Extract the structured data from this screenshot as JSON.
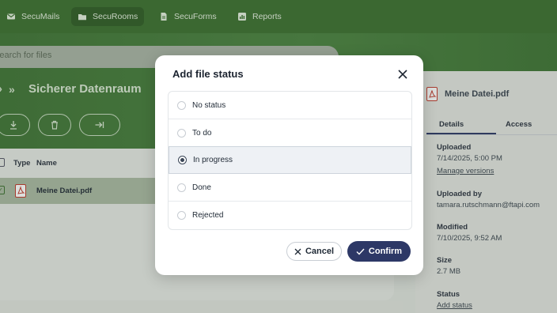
{
  "nav": {
    "items": [
      {
        "label": "SecuMails",
        "icon": "mail-icon"
      },
      {
        "label": "SecuRooms",
        "icon": "folder-icon",
        "active": true
      },
      {
        "label": "SecuForms",
        "icon": "form-icon"
      },
      {
        "label": "Reports",
        "icon": "chart-icon"
      }
    ]
  },
  "search": {
    "placeholder": "Search for files"
  },
  "room": {
    "title": "Sicherer Datenraum"
  },
  "table": {
    "headers": [
      "Type",
      "Name"
    ],
    "rows": [
      {
        "name": "Meine Datei.pdf",
        "type_icon": "pdf-icon"
      }
    ]
  },
  "side_panel": {
    "file_name": "Meine Datei.pdf",
    "tabs": [
      "Details",
      "Access"
    ],
    "uploaded_label": "Uploaded",
    "uploaded_value": "7/14/2025, 5:00 PM",
    "manage_versions": "Manage versions",
    "uploaded_by_label": "Uploaded by",
    "uploaded_by_value": "tamara.rutschmann@ftapi.com",
    "modified_label": "Modified",
    "modified_value": "7/10/2025, 9:52 AM",
    "size_label": "Size",
    "size_value": "2.7 MB",
    "status_label": "Status",
    "add_status": "Add status"
  },
  "modal": {
    "title": "Add file status",
    "options": [
      {
        "label": "No status",
        "checked": false
      },
      {
        "label": "To do",
        "checked": false
      },
      {
        "label": "In progress",
        "checked": true
      },
      {
        "label": "Done",
        "checked": false
      },
      {
        "label": "Rejected",
        "checked": false
      }
    ],
    "cancel_label": "Cancel",
    "confirm_label": "Confirm"
  },
  "colors": {
    "brand_green": "#3b6f2f",
    "confirm_blue": "#2d3866",
    "pdf_red": "#c0392b"
  }
}
